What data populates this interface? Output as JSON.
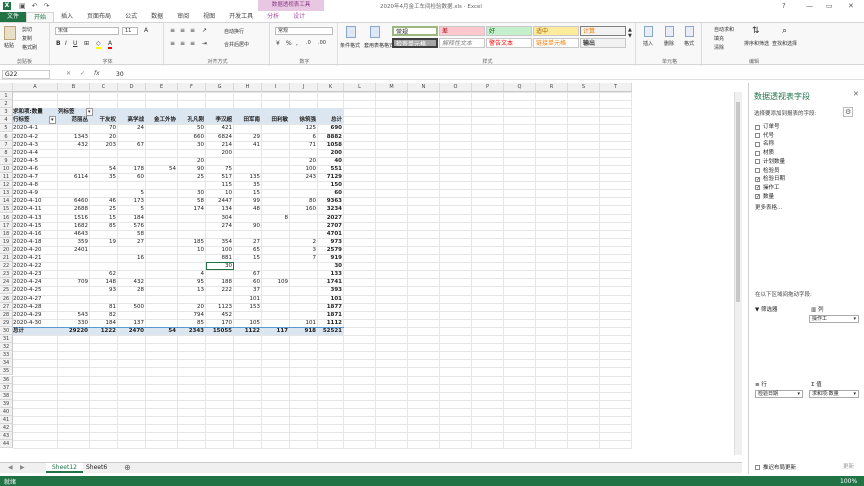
{
  "window": {
    "title": "2020年4月金工车间检验数据.xls - Excel",
    "context_tool": "数据透视表工具"
  },
  "tabs": [
    "文件",
    "开始",
    "插入",
    "页面布局",
    "公式",
    "数据",
    "审阅",
    "视图",
    "开发工具",
    "分析",
    "设计"
  ],
  "ribbon": {
    "clipboard": {
      "paste": "粘贴",
      "cut": "剪切",
      "copy": "复制",
      "painter": "格式刷",
      "label": "剪贴板"
    },
    "font": {
      "name": "宋体",
      "size": "11",
      "label": "字体"
    },
    "align": {
      "wrap": "自动换行",
      "merge": "合并后居中",
      "label": "对齐方式"
    },
    "number": {
      "format": "常规",
      "label": "数字"
    },
    "styles": {
      "cond": "条件格式",
      "table": "套用表格格式",
      "label": "样式",
      "cells": [
        "常规",
        "差",
        "好",
        "适中",
        "计算",
        "检查单元格",
        "解释性文本",
        "警告文本",
        "链接单元格",
        "输出"
      ]
    },
    "cellsgrp": {
      "insert": "插入",
      "delete": "删除",
      "format": "格式",
      "label": "单元格"
    },
    "edit": {
      "autosum": "自动求和",
      "fill": "填充",
      "clear": "清除",
      "sort": "排序和筛选",
      "find": "查找和选择",
      "label": "编辑"
    }
  },
  "formula_bar": {
    "namebox": "G22",
    "fx": "fx",
    "value": "30"
  },
  "columns": [
    "A",
    "B",
    "C",
    "D",
    "E",
    "F",
    "G",
    "H",
    "I",
    "J",
    "K",
    "L",
    "M",
    "N",
    "O",
    "P",
    "Q",
    "R",
    "S",
    "T"
  ],
  "pivot": {
    "r3": [
      "求和项:数量",
      "列标签"
    ],
    "headers": [
      "行标签",
      "范丽丛",
      "干友权",
      "高学战",
      "金工外协",
      "孔凡刚",
      "李汉超",
      "田军南",
      "田利敏",
      "徐筑强",
      "总计"
    ],
    "rows": [
      [
        "2020-4-1",
        "",
        "70",
        "24",
        "",
        "50",
        "421",
        "",
        "",
        "125",
        "690"
      ],
      [
        "2020-4-2",
        "1343",
        "20",
        "",
        "",
        "660",
        "6824",
        "29",
        "",
        "6",
        "8882"
      ],
      [
        "2020-4-3",
        "432",
        "203",
        "67",
        "",
        "30",
        "214",
        "41",
        "",
        "71",
        "1058"
      ],
      [
        "2020-4-4",
        "",
        "",
        "",
        "",
        "",
        "200",
        "",
        "",
        "",
        "200"
      ],
      [
        "2020-4-5",
        "",
        "",
        "",
        "",
        "20",
        "",
        "",
        "",
        "20",
        "40"
      ],
      [
        "2020-4-6",
        "",
        "54",
        "178",
        "54",
        "90",
        "75",
        "",
        "",
        "100",
        "551"
      ],
      [
        "2020-4-7",
        "6114",
        "35",
        "60",
        "",
        "25",
        "517",
        "135",
        "",
        "243",
        "7129"
      ],
      [
        "2020-4-8",
        "",
        "",
        "",
        "",
        "",
        "115",
        "35",
        "",
        "",
        "150"
      ],
      [
        "2020-4-9",
        "",
        "",
        "5",
        "",
        "30",
        "10",
        "15",
        "",
        "",
        "60"
      ],
      [
        "2020-4-10",
        "6460",
        "46",
        "173",
        "",
        "58",
        "2447",
        "99",
        "",
        "80",
        "9363"
      ],
      [
        "2020-4-11",
        "2688",
        "25",
        "5",
        "",
        "174",
        "134",
        "48",
        "",
        "160",
        "3234"
      ],
      [
        "2020-4-13",
        "1516",
        "15",
        "184",
        "",
        "",
        "304",
        "",
        "8",
        "",
        "2027"
      ],
      [
        "2020-4-15",
        "1682",
        "85",
        "576",
        "",
        "",
        "274",
        "90",
        "",
        "",
        "2707"
      ],
      [
        "2020-4-16",
        "4643",
        "",
        "58",
        "",
        "",
        "",
        "",
        "",
        "",
        "4701"
      ],
      [
        "2020-4-18",
        "359",
        "19",
        "27",
        "",
        "185",
        "354",
        "27",
        "",
        "2",
        "973"
      ],
      [
        "2020-4-20",
        "2401",
        "",
        "",
        "",
        "10",
        "100",
        "65",
        "",
        "3",
        "2579"
      ],
      [
        "2020-4-21",
        "",
        "",
        "16",
        "",
        "",
        "881",
        "15",
        "",
        "7",
        "919"
      ],
      [
        "2020-4-22",
        "",
        "",
        "",
        "",
        "",
        "30",
        "",
        "",
        "",
        "30"
      ],
      [
        "2020-4-23",
        "",
        "62",
        "",
        "",
        "4",
        "",
        "67",
        "",
        "",
        "133"
      ],
      [
        "2020-4-24",
        "709",
        "148",
        "432",
        "",
        "95",
        "188",
        "60",
        "109",
        "",
        "1741"
      ],
      [
        "2020-4-25",
        "",
        "93",
        "28",
        "",
        "13",
        "222",
        "37",
        "",
        "",
        "393"
      ],
      [
        "2020-4-27",
        "",
        "",
        "",
        "",
        "",
        "",
        "101",
        "",
        "",
        "101"
      ],
      [
        "2020-4-28",
        "",
        "81",
        "500",
        "",
        "20",
        "1123",
        "153",
        "",
        "",
        "1877"
      ],
      [
        "2020-4-29",
        "543",
        "82",
        "",
        "",
        "794",
        "452",
        "",
        "",
        "",
        "1871"
      ],
      [
        "2020-4-30",
        "330",
        "184",
        "137",
        "",
        "85",
        "170",
        "105",
        "",
        "101",
        "1112"
      ]
    ],
    "total": [
      "总计",
      "29220",
      "1222",
      "2470",
      "54",
      "2343",
      "15055",
      "1122",
      "117",
      "918",
      "52521"
    ]
  },
  "sheets": [
    "Sheet12",
    "Sheet6"
  ],
  "status": {
    "left": "就绪",
    "zoom": "100%"
  },
  "pane": {
    "title": "数据透视表字段",
    "subtitle": "选择要添加到报表的字段:",
    "fields": [
      {
        "name": "订单号",
        "checked": false
      },
      {
        "name": "代号",
        "checked": false
      },
      {
        "name": "名称",
        "checked": false
      },
      {
        "name": "材质",
        "checked": false
      },
      {
        "name": "计划数量",
        "checked": false
      },
      {
        "name": "检验员",
        "checked": false
      },
      {
        "name": "检验日期",
        "checked": true
      },
      {
        "name": "操作工",
        "checked": true
      },
      {
        "name": "数量",
        "checked": true
      }
    ],
    "more": "更多表格...",
    "drag": "在以下区域间拖动字段:",
    "filter": "筛选器",
    "cols": "列",
    "rows": "行",
    "values": "值",
    "col_item": "操作工",
    "row_item": "检验日期",
    "val_item": "求和项:数量",
    "defer": "推迟布局更新",
    "update": "更新"
  }
}
